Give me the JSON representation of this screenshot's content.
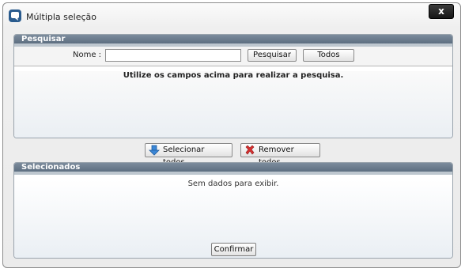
{
  "window": {
    "title": "Múltipla seleção",
    "close_label": "x"
  },
  "search_panel": {
    "header": "Pesquisar",
    "name_label": "Nome :",
    "name_value": "",
    "search_button": "Pesquisar",
    "all_button": "Todos",
    "hint": "Utilize os campos acima para realizar a pesquisa."
  },
  "actions": {
    "select_all": "Selecionar todos",
    "remove_all": "Remover todos"
  },
  "selected_panel": {
    "header": "Selecionados",
    "empty_text": "Sem dados para exibir."
  },
  "confirm_button": "Confirmar",
  "colors": {
    "panel_header": "#6b7b8c",
    "close_button": "#222222",
    "select_icon": "#3a86d6",
    "remove_icon": "#d83030"
  },
  "icons": {
    "window": "window-icon",
    "select_all": "arrow-down-icon",
    "remove_all": "x-mark-icon"
  }
}
